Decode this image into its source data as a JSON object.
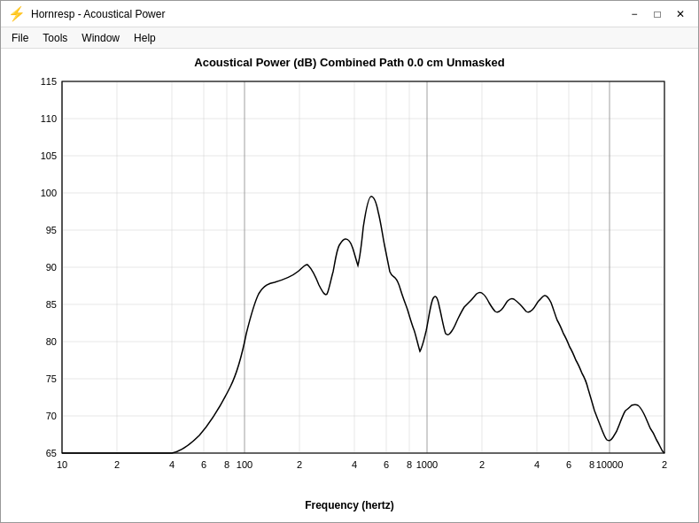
{
  "window": {
    "title": "Hornresp - Acoustical Power",
    "icon": "⚡"
  },
  "titlebar": {
    "minimize_label": "−",
    "maximize_label": "□",
    "close_label": "✕"
  },
  "menu": {
    "items": [
      "File",
      "Tools",
      "Window",
      "Help"
    ]
  },
  "chart": {
    "title": "Acoustical Power (dB)   Combined   Path 0.0 cm   Unmasked",
    "x_label": "Frequency (hertz)",
    "y_min": 65,
    "y_max": 115,
    "y_step": 5,
    "y_labels": [
      115,
      110,
      105,
      100,
      95,
      90,
      85,
      80,
      75,
      70,
      65
    ],
    "x_labels": [
      "10",
      "2",
      "4",
      "6",
      "8",
      "100",
      "2",
      "4",
      "6",
      "8",
      "1000",
      "2",
      "4",
      "6",
      "8",
      "10000",
      "2"
    ]
  }
}
